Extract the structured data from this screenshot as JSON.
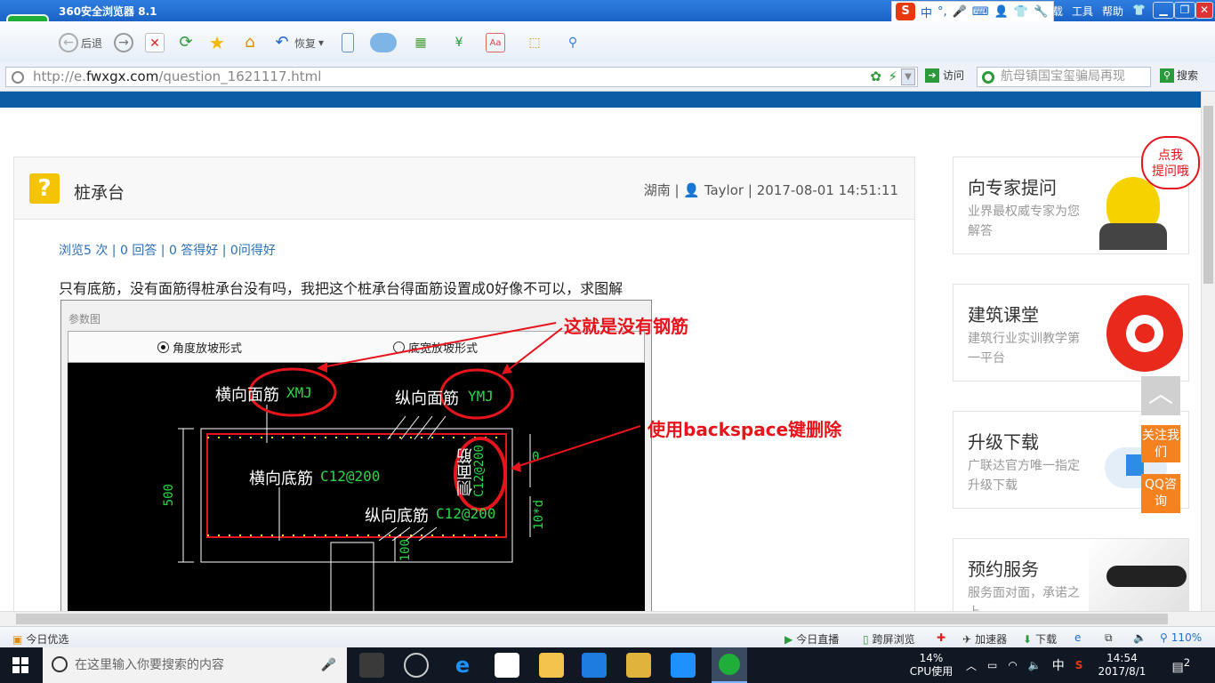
{
  "window": {
    "title": "360安全浏览器 8.1",
    "logo_glyph": "e",
    "menus": [
      "工具",
      "帮助"
    ],
    "menu_partial": "载",
    "buttons": {
      "minimize": "▁",
      "restore": "❐",
      "close": "✕"
    }
  },
  "ime": {
    "logo": "S",
    "mode": "中",
    "punct": "°,"
  },
  "toolbar": {
    "back_label": "后退",
    "restore_label": "恢复"
  },
  "address": {
    "url_prefix": "http://e.",
    "url_domain": "fwxgx.com",
    "url_path": "/question_1621117.html",
    "go_label": "访问",
    "search_placeholder": "航母镇国宝玺骗局再现",
    "search_label": "搜索"
  },
  "question": {
    "icon": "?",
    "title": "桩承台",
    "meta": {
      "region": "湖南",
      "author": "Taylor",
      "datetime": "2017-08-01 14:51:11"
    },
    "stats": "浏览5 次 | 0 回答 | 0 答得好 | 0问得好",
    "body": "只有底筋，没有面筋得桩承台没有吗，我把这个桩承台得面筋设置成0好像不可以，求图解"
  },
  "embedded_image": {
    "window_title": "参数图",
    "radio_1": "角度放坡形式",
    "radio_2": "底宽放坡形式",
    "annotation_1": "这就是没有钢筋",
    "annotation_2": "使用backspace键删除",
    "cad": {
      "top_cross_label": "横向面筋",
      "top_cross_code": "XMJ",
      "top_long_label": "纵向面筋",
      "top_long_code": "YMJ",
      "bot_cross_label": "横向底筋",
      "bot_cross_code": "C12@200",
      "bot_long_label": "纵向底筋",
      "bot_long_code": "C12@200",
      "side_label": "侧面筋",
      "side_code": "C12@200",
      "dim_height": "500",
      "dim_cover": "100",
      "dim_anchor": "10*d",
      "dim_zero": "0"
    }
  },
  "sidebar": {
    "bubble": "点我\n提问哦",
    "cards": [
      {
        "title": "向专家提问",
        "sub": "业界最权威专家为您解答"
      },
      {
        "title": "建筑课堂",
        "sub": "建筑行业实训教学第一平台"
      },
      {
        "title": "升级下载",
        "sub": "广联达官方唯一指定升级下载"
      },
      {
        "title": "预约服务",
        "sub": "服务面对面，承诺之上"
      }
    ],
    "float_follow": "关注我们",
    "float_qq": "QQ咨询",
    "float_top": "︿"
  },
  "statusbar": {
    "left": "今日优选",
    "live": "今日直播",
    "cross_screen": "跨屏浏览",
    "accelerator": "加速器",
    "download": "下载",
    "zoom": "110%"
  },
  "taskbar": {
    "search_placeholder": "在这里输入你要搜索的内容",
    "cpu_percent": "14%",
    "cpu_label": "CPU使用",
    "ime": "中",
    "time": "14:54",
    "date": "2017/8/1",
    "notifications": "2"
  }
}
